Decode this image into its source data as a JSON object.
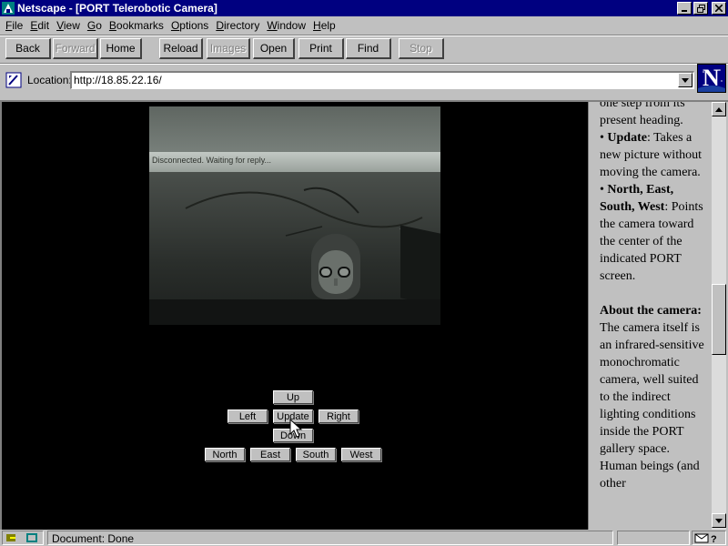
{
  "window": {
    "title": "Netscape - [PORT Telerobotic Camera]"
  },
  "menu": [
    {
      "key": "F",
      "rest": "ile"
    },
    {
      "key": "E",
      "rest": "dit"
    },
    {
      "key": "V",
      "rest": "iew"
    },
    {
      "key": "G",
      "rest": "o"
    },
    {
      "key": "B",
      "rest": "ookmarks"
    },
    {
      "key": "O",
      "rest": "ptions"
    },
    {
      "key": "D",
      "rest": "irectory"
    },
    {
      "key": "W",
      "rest": "indow"
    },
    {
      "key": "H",
      "rest": "elp"
    }
  ],
  "toolbar": {
    "back": "Back",
    "forward": "Forward",
    "home": "Home",
    "reload": "Reload",
    "images": "Images",
    "open": "Open",
    "print": "Print",
    "find": "Find",
    "stop": "Stop"
  },
  "location": {
    "label": "Location:",
    "url": "http://18.85.22.16/"
  },
  "camera": {
    "overlay_text": "Disconnected. Waiting for reply..."
  },
  "controls": {
    "up": "Up",
    "left": "Left",
    "update": "Update",
    "right": "Right",
    "down": "Down",
    "north": "North",
    "east": "East",
    "south": "South",
    "west": "West"
  },
  "sidebar": {
    "intro_fragment": "one step from its present heading.",
    "update_term": "Update",
    "update_desc": ": Takes a new picture without moving the camera.",
    "compass_term": "North, East, South, West",
    "compass_desc": ": Points the camera toward the center of the indicated PORT screen.",
    "about_heading": "About the camera:",
    "about_text": "The camera itself is an infrared-sensitive monochromatic camera, well suited to the indirect lighting conditions inside the PORT gallery space. Human beings (and other"
  },
  "status": {
    "text": "Document: Done"
  },
  "colors": {
    "title_bar": "#000080",
    "chrome": "#c0c0c0",
    "page_background": "#000000"
  }
}
